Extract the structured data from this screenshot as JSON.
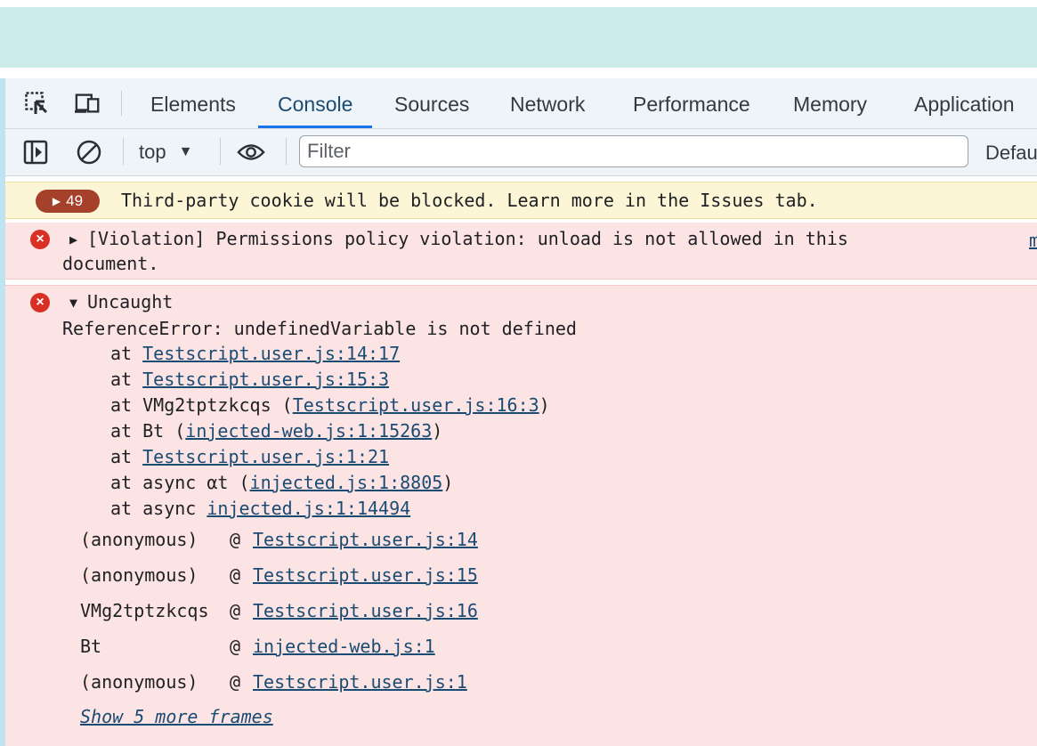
{
  "tabs": [
    "Elements",
    "Console",
    "Sources",
    "Network",
    "Performance",
    "Memory",
    "Application"
  ],
  "active_tab": "Console",
  "toolbar": {
    "context": "top",
    "filter_placeholder": "Filter",
    "levels_label": "Defau"
  },
  "icons": {
    "inspect": "inspect-element-icon",
    "device": "device-toolbar-icon",
    "sidebar": "sidebar-toggle-icon",
    "clear": "clear-console-icon",
    "eye": "live-expression-eye-icon",
    "error": "error-icon"
  },
  "colors": {
    "error_bg": "#fce4e4",
    "warning_bg": "#fdf6d6",
    "issue_badge": "#a5402a",
    "link": "#1a4b73",
    "tab_underline": "#1a73e8"
  },
  "messages": {
    "issues_badge_count": "49",
    "issues_text": "Third-party cookie will be blocked. Learn more in the Issues tab.",
    "violation": {
      "line1": "[Violation] Permissions policy violation: unload is not allowed in this",
      "line2": "document.",
      "source_cut": "m"
    },
    "uncaught": {
      "header": "Uncaught",
      "error_line": "ReferenceError: undefinedVariable is not defined",
      "stack": [
        {
          "prefix": "at ",
          "link": "Testscript.user.js:14:17",
          "suffix": ""
        },
        {
          "prefix": "at ",
          "link": "Testscript.user.js:15:3",
          "suffix": ""
        },
        {
          "prefix": "at VMg2tptzkcqs (",
          "link": "Testscript.user.js:16:3",
          "suffix": ")"
        },
        {
          "prefix": "at Bt (",
          "link": "injected-web.js:1:15263",
          "suffix": ")"
        },
        {
          "prefix": "at ",
          "link": "Testscript.user.js:1:21",
          "suffix": ""
        },
        {
          "prefix": "at async αt (",
          "link": "injected.js:1:8805",
          "suffix": ")"
        },
        {
          "prefix": "at async ",
          "link": "injected.js:1:14494",
          "suffix": ""
        }
      ],
      "frames": [
        {
          "fn": "(anonymous)",
          "at": "@",
          "link": "Testscript.user.js:14"
        },
        {
          "fn": "(anonymous)",
          "at": "@",
          "link": "Testscript.user.js:15"
        },
        {
          "fn": "VMg2tptzkcqs",
          "at": "@",
          "link": "Testscript.user.js:16"
        },
        {
          "fn": "Bt",
          "at": "@",
          "link": "injected-web.js:1"
        },
        {
          "fn": "(anonymous)",
          "at": "@",
          "link": "Testscript.user.js:1"
        }
      ],
      "show_more": "Show 5 more frames"
    }
  }
}
